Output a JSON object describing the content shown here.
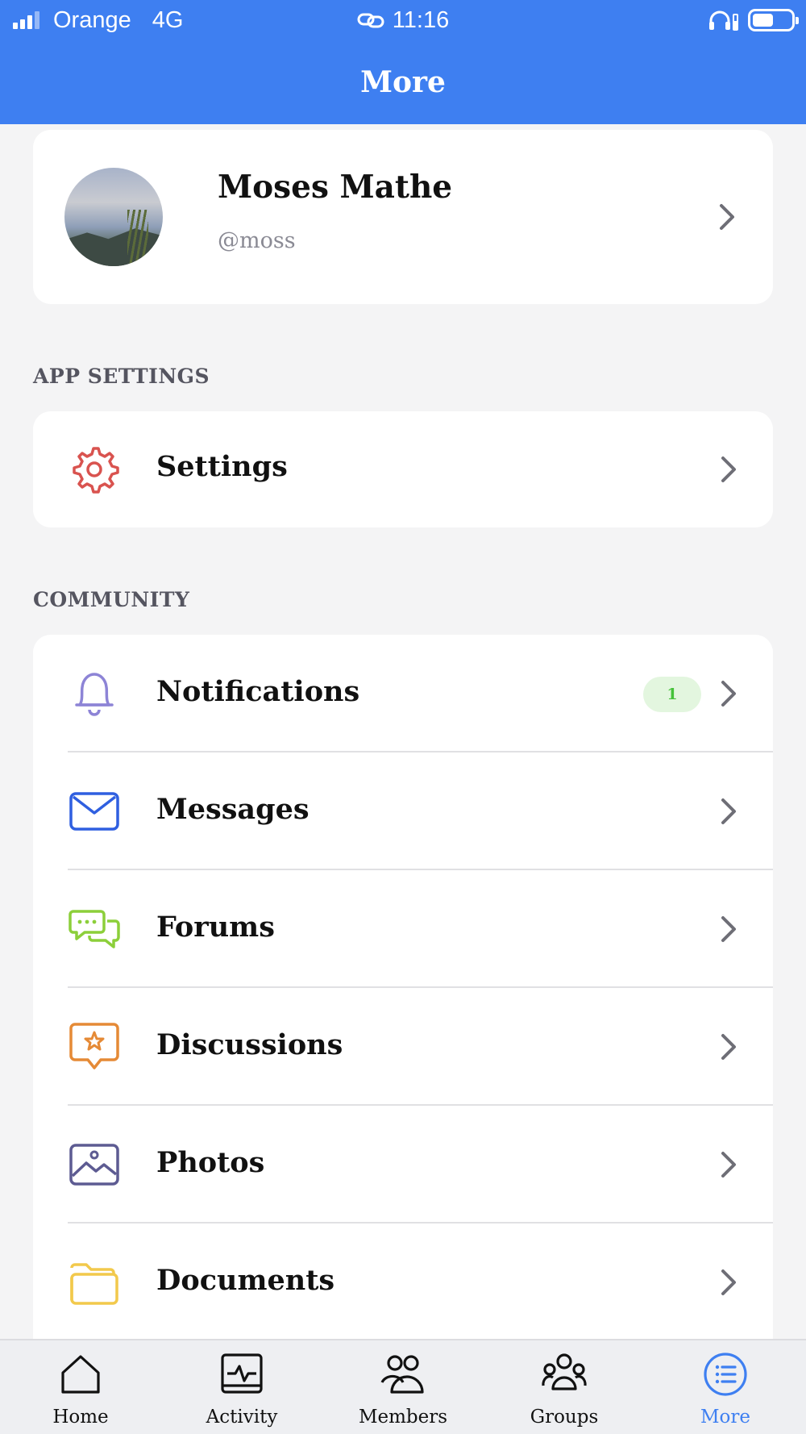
{
  "status_bar": {
    "carrier": "Orange",
    "network": "4G",
    "time": "11:16",
    "battery_level": 0.55,
    "signal_bars": 3,
    "icons": [
      "signal-icon",
      "link-icon",
      "headphones-icon",
      "battery-icon"
    ]
  },
  "header": {
    "title": "More"
  },
  "profile": {
    "name": "Moses Mathe",
    "handle": "@moss"
  },
  "sections": {
    "app_settings": {
      "title": "APP SETTINGS",
      "items": [
        {
          "label": "Settings",
          "icon": "gear-icon",
          "color": "#d9534f"
        }
      ]
    },
    "community": {
      "title": "COMMUNITY",
      "items": [
        {
          "label": "Notifications",
          "icon": "bell-icon",
          "color": "#8d84d6",
          "badge": "1"
        },
        {
          "label": "Messages",
          "icon": "envelope-icon",
          "color": "#2f5fe0"
        },
        {
          "label": "Forums",
          "icon": "chat-bubbles-icon",
          "color": "#8ccf3a"
        },
        {
          "label": "Discussions",
          "icon": "star-speech-icon",
          "color": "#e58a36"
        },
        {
          "label": "Photos",
          "icon": "photo-icon",
          "color": "#5d5b92"
        },
        {
          "label": "Documents",
          "icon": "folder-icon",
          "color": "#f2c94c"
        }
      ]
    }
  },
  "tabbar": {
    "active_color": "#3e7ff1",
    "items": [
      {
        "label": "Home",
        "icon": "home-icon"
      },
      {
        "label": "Activity",
        "icon": "activity-icon"
      },
      {
        "label": "Members",
        "icon": "members-icon"
      },
      {
        "label": "Groups",
        "icon": "groups-icon"
      },
      {
        "label": "More",
        "icon": "more-list-icon",
        "active": true
      }
    ]
  }
}
